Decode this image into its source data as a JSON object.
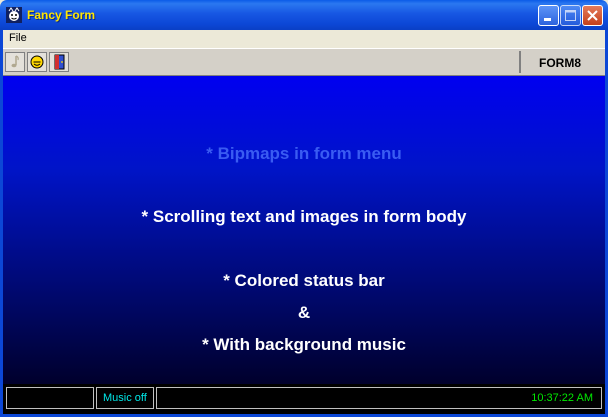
{
  "window": {
    "title": "Fancy Form"
  },
  "menu": {
    "file_label": "File"
  },
  "toolbar": {
    "tools": [
      "music-note-icon",
      "smiley-icon",
      "exit-door-icon"
    ],
    "form_label": "FORM8"
  },
  "body": {
    "lines": [
      "* Bipmaps in form menu",
      "* Scrolling text and images in form body",
      "* Colored status bar",
      "&",
      "* With background music"
    ]
  },
  "status": {
    "panel1": "",
    "music": "Music off",
    "time": "10:37:22 AM"
  },
  "colors": {
    "title_text": "#ffe600",
    "status_music": "#00e8e8",
    "status_time": "#00e800"
  }
}
